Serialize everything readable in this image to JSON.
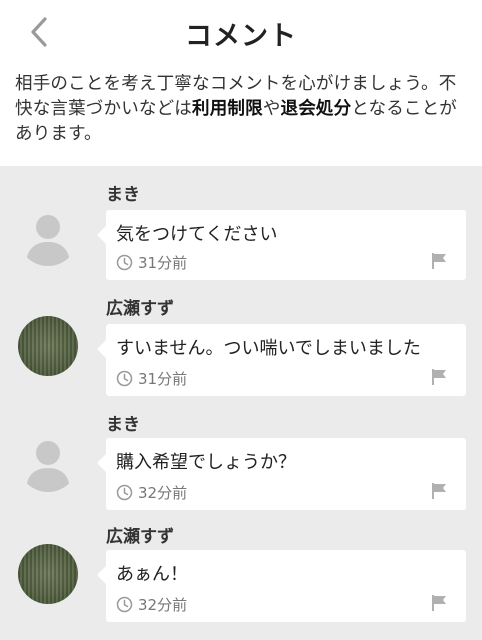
{
  "header": {
    "title": "コメント",
    "back_icon": "chevron-left-icon"
  },
  "notice": {
    "text_1": "相手のことを考え丁寧なコメントを心がけましょう。不快な言葉づかいなどは",
    "bold_1": "利用制限",
    "text_2": "や",
    "bold_2": "退会処分",
    "text_3": "となることがあります。"
  },
  "comments": [
    {
      "user": "まき",
      "text": "気をつけてください",
      "time": "31分前",
      "avatar": "default"
    },
    {
      "user": "広瀬すず",
      "text": "すいません。つい喘いでしまいました",
      "time": "31分前",
      "avatar": "photo"
    },
    {
      "user": "まき",
      "text": "購入希望でしょうか？",
      "time": "32分前",
      "avatar": "default"
    },
    {
      "user": "広瀬すず",
      "text": "あぁん！",
      "time": "32分前",
      "avatar": "photo"
    }
  ],
  "colors": {
    "feed_bg": "#ebebeb",
    "bubble_bg": "#ffffff",
    "icon_gray": "#b0b0b0",
    "avatar_gray": "#c8c8c8"
  }
}
